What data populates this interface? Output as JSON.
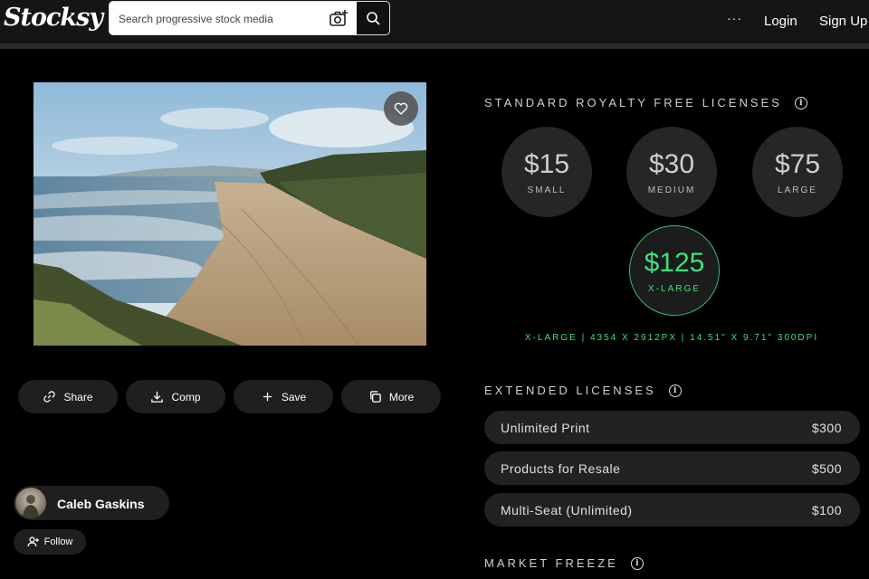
{
  "header": {
    "logo": "Stocksy",
    "search_placeholder": "Search progressive stock media",
    "more": "···",
    "login": "Login",
    "signup": "Sign Up"
  },
  "actions": [
    {
      "label": "Share",
      "icon": "link-icon"
    },
    {
      "label": "Comp",
      "icon": "download-icon"
    },
    {
      "label": "Save",
      "icon": "plus-icon"
    },
    {
      "label": "More",
      "icon": "copy-icon"
    }
  ],
  "author": {
    "name": "Caleb Gaskins",
    "follow": "Follow"
  },
  "standard": {
    "title": "STANDARD ROYALTY FREE LICENSES",
    "options": [
      {
        "price": "$15",
        "size": "SMALL"
      },
      {
        "price": "$30",
        "size": "MEDIUM"
      },
      {
        "price": "$75",
        "size": "LARGE"
      },
      {
        "price": "$125",
        "size": "X-LARGE"
      }
    ],
    "selected_spec": "X-LARGE | 4354 X 2912PX | 14.51\" X 9.71\" 300DPI"
  },
  "extended": {
    "title": "EXTENDED LICENSES",
    "rows": [
      {
        "label": "Unlimited Print",
        "price": "$300"
      },
      {
        "label": "Products for Resale",
        "price": "$500"
      },
      {
        "label": "Multi-Seat (Unlimited)",
        "price": "$100"
      }
    ]
  },
  "market_freeze": {
    "title": "MARKET FREEZE"
  },
  "colors": {
    "accent": "#3ee07f",
    "background": "#000000",
    "pill": "#222222"
  }
}
